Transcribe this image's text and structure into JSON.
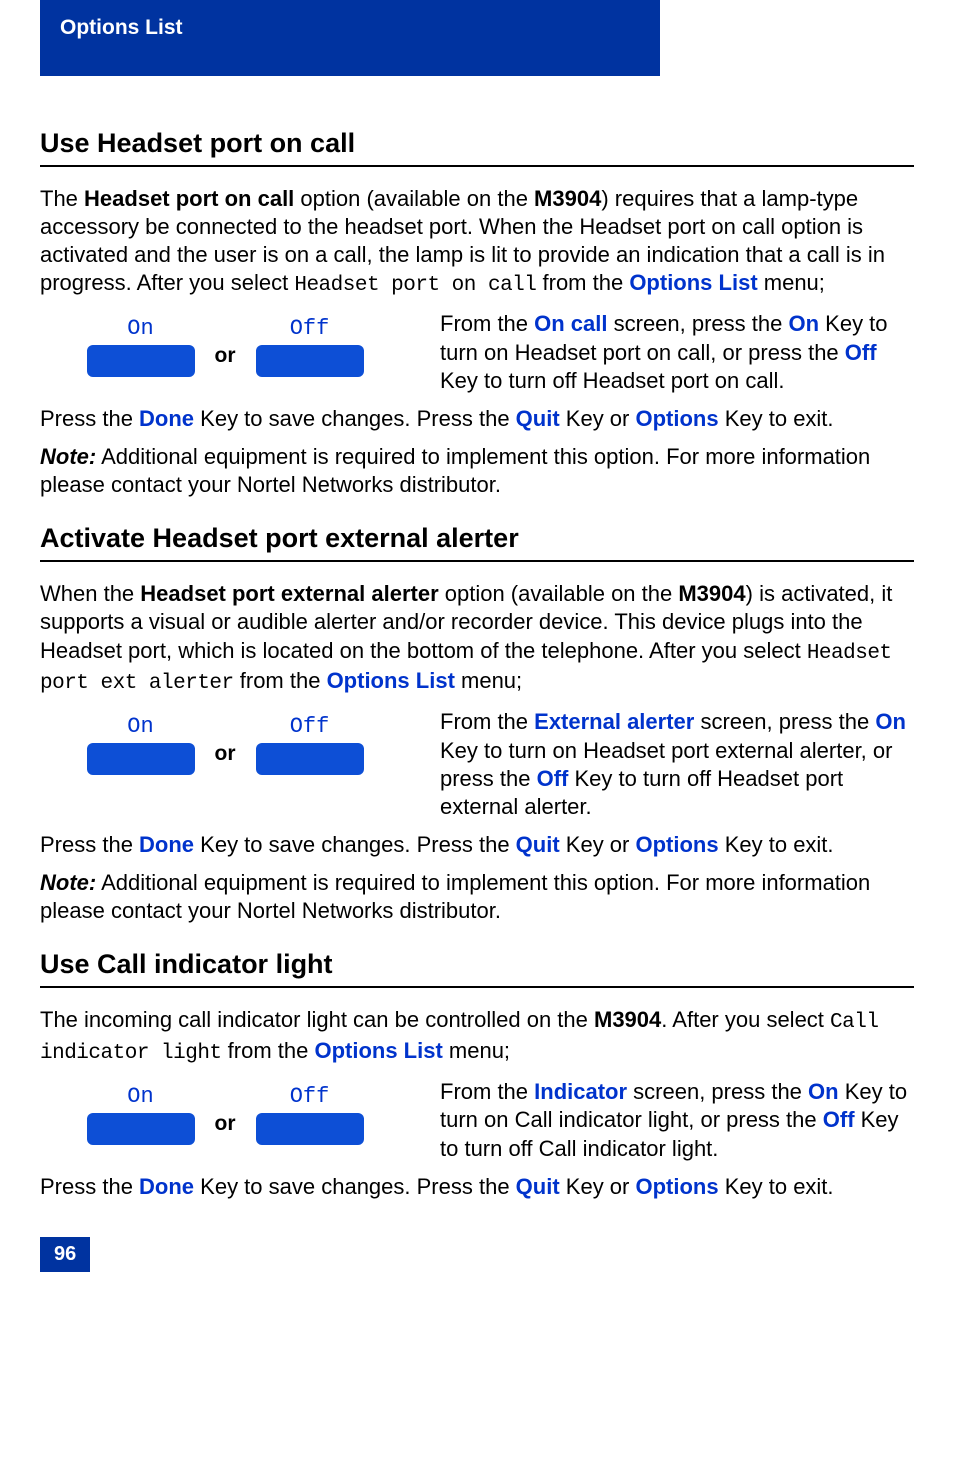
{
  "header": {
    "tab": "Options List"
  },
  "section1": {
    "title": "Use Headset port on call",
    "intro_pre": "The ",
    "intro_b1": "Headset port on call",
    "intro_mid1": " option (available on the ",
    "intro_b2": "M3904",
    "intro_mid2": ") requires that a lamp-type accessory be connected to the headset port. When the Headset port on call option is activated and the user is on a call, the lamp is lit to provide an indication that a call is in progress. After you select ",
    "intro_mono": "Headset port on call",
    "intro_mid3": " from the ",
    "intro_link": "Options List",
    "intro_end": " menu;",
    "key_on": "On",
    "key_off": "Off",
    "or": "or",
    "desc_pre": "From the ",
    "desc_l1": "On call",
    "desc_mid1": " screen, press the ",
    "desc_l2": "On",
    "desc_mid2": " Key to turn on Headset port on call, or press the ",
    "desc_l3": "Off",
    "desc_end": " Key to turn off Headset port on call.",
    "done_pre": "Press the ",
    "done_l1": "Done",
    "done_mid1": " Key to save changes. Press the ",
    "done_l2": "Quit",
    "done_mid2": " Key or ",
    "done_l3": "Options",
    "done_end": " Key to exit.",
    "note_label": "Note:",
    "note_text": " Additional equipment is required to implement this option. For more information please contact your Nortel Networks distributor."
  },
  "section2": {
    "title": "Activate Headset port external alerter",
    "intro_pre": "When the ",
    "intro_b1": "Headset port external alerter",
    "intro_mid1": " option (available on the ",
    "intro_b2": "M3904",
    "intro_mid2": ") is activated,  it supports a visual or audible alerter and/or recorder device. This device plugs into the Headset port, which is located on the bottom of the telephone. After you select ",
    "intro_mono": "Headset port ext alerter",
    "intro_mid3": " from the ",
    "intro_link": "Options List",
    "intro_end": " menu;",
    "key_on": "On",
    "key_off": "Off",
    "or": "or",
    "desc_pre": "From the ",
    "desc_l1": "External alerter",
    "desc_mid1": " screen, press the ",
    "desc_l2": "On",
    "desc_mid2": " Key to turn on Headset port external alerter, or press the ",
    "desc_l3": "Off",
    "desc_end": " Key to turn off Headset port external alerter.",
    "done_pre": "Press the ",
    "done_l1": "Done",
    "done_mid1": " Key to save changes. Press the ",
    "done_l2": "Quit",
    "done_mid2": " Key or ",
    "done_l3": "Options",
    "done_end": " Key to exit.",
    "note_label": "Note:",
    "note_text": " Additional equipment is required to implement this option. For more information please contact your Nortel Networks distributor."
  },
  "section3": {
    "title": "Use Call indicator light",
    "intro_pre": "The incoming call indicator light can be controlled on the ",
    "intro_b1": "M3904",
    "intro_mid1": ". After you select ",
    "intro_mono": "Call indicator light",
    "intro_mid2": " from the ",
    "intro_link": "Options List",
    "intro_end": " menu;",
    "key_on": "On",
    "key_off": "Off",
    "or": "or",
    "desc_pre": "From the ",
    "desc_l1": "Indicator",
    "desc_mid1": " screen, press the ",
    "desc_l2": "On",
    "desc_mid2": " Key to turn on Call indicator light, or press the ",
    "desc_l3": "Off",
    "desc_end": " Key to turn off Call indicator light.",
    "done_pre": "Press the ",
    "done_l1": "Done",
    "done_mid1": " Key to save changes. Press the ",
    "done_l2": "Quit",
    "done_mid2": " Key or ",
    "done_l3": "Options",
    "done_end": " Key to exit."
  },
  "page_number": "96"
}
